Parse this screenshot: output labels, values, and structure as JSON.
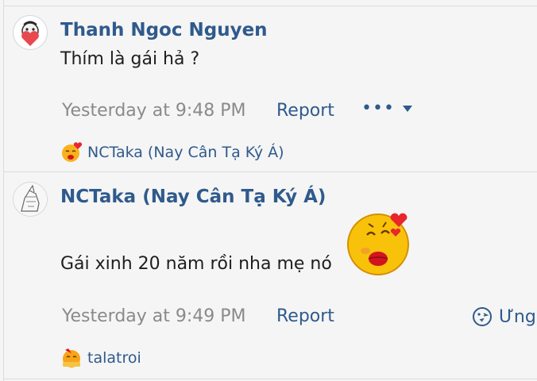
{
  "posts": [
    {
      "username": "Thanh Ngoc Nguyen",
      "message": "Thím là gái hả ?",
      "timestamp": "Yesterday at 9:48 PM",
      "report_label": "Report",
      "reaction_user": "NCTaka (Nay Cân Tạ Ký Á)"
    },
    {
      "username": "NCTaka (Nay Cân Tạ Ký Á)",
      "message": "Gái xinh 20 năm rồi nha mẹ nó",
      "timestamp": "Yesterday at 9:49 PM",
      "report_label": "Report",
      "reaction_user": "talatroi"
    }
  ],
  "more_menu": {
    "label": "•••"
  },
  "reaction_button": {
    "label": "Ưng"
  },
  "icons": {
    "more": "ellipsis-icon",
    "dropdown": "caret-down-icon",
    "reaction": "kiss-emoji-icon",
    "ung": "smile-face-icon"
  },
  "colors": {
    "link": "#2f5a8c",
    "muted": "#8a8a8a",
    "text": "#1e1e1e",
    "background": "#f5f5f5"
  }
}
